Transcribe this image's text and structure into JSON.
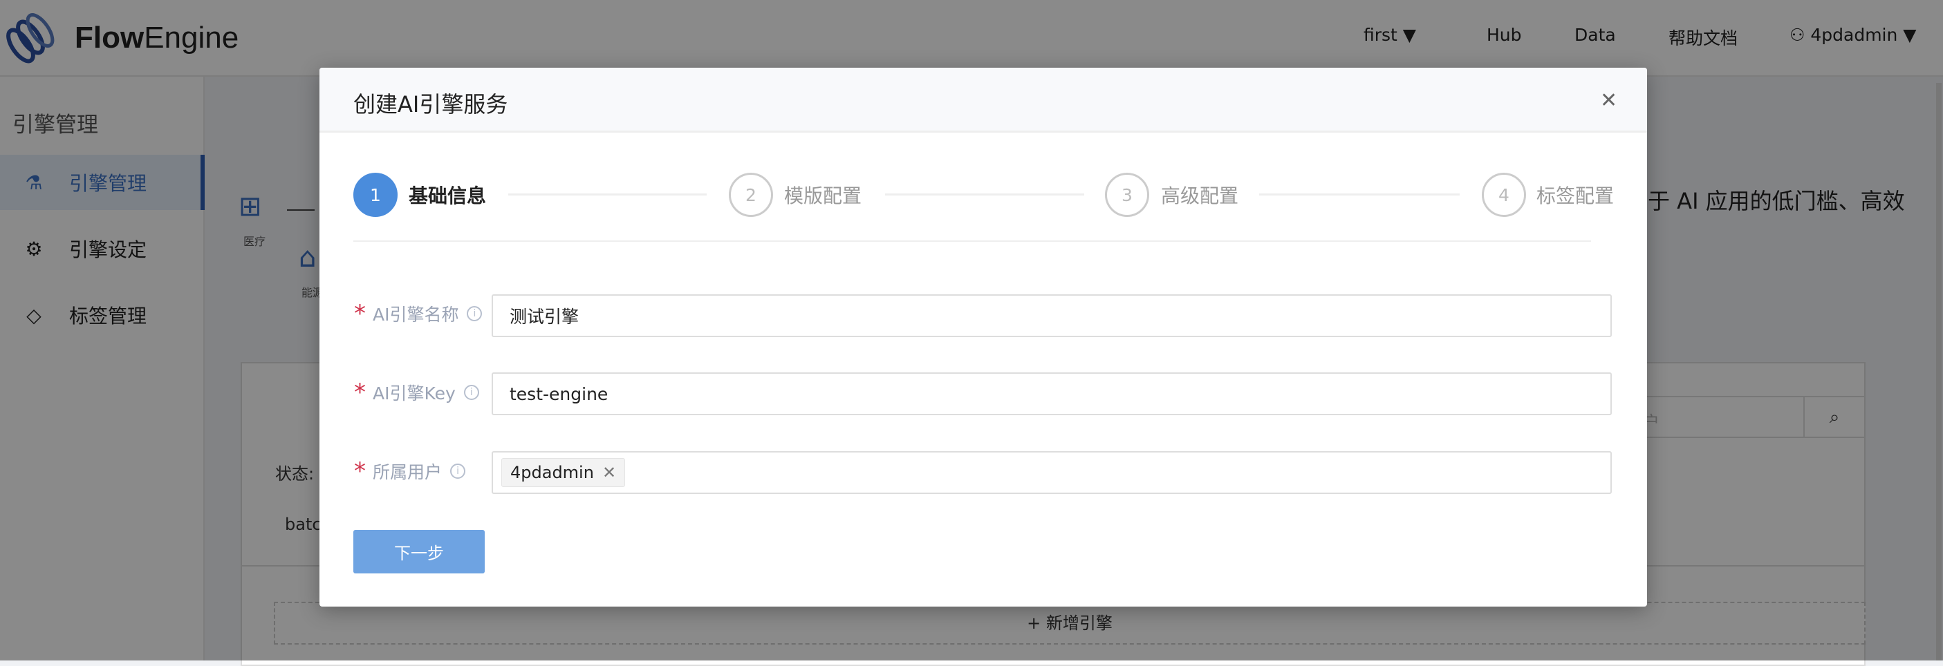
{
  "header": {
    "brand": {
      "bold": "Flow",
      "light": "Engine"
    },
    "project": "first",
    "nav": [
      "Hub",
      "Data",
      "帮助文档"
    ],
    "user": "4pdadmin"
  },
  "sidebar": {
    "title": "引擎管理",
    "items": [
      {
        "label": "引擎管理",
        "icon": "flask-icon",
        "active": true
      },
      {
        "label": "引擎设定",
        "icon": "gear-icon"
      },
      {
        "label": "标签管理",
        "icon": "tag-icon"
      }
    ]
  },
  "background": {
    "intro": "于 AI 应用的低门槛、高效",
    "icons": [
      "医疗",
      "能源"
    ],
    "status_label": "状态:",
    "row_text": "batc",
    "search_placeholder": "用户",
    "add_button": "+ 新增引擎"
  },
  "modal": {
    "title": "创建AI引擎服务",
    "steps": [
      {
        "num": "1",
        "label": "基础信息"
      },
      {
        "num": "2",
        "label": "模版配置"
      },
      {
        "num": "3",
        "label": "高级配置"
      },
      {
        "num": "4",
        "label": "标签配置"
      }
    ],
    "current_step": 1,
    "fields": [
      {
        "label": "AI引擎名称",
        "value": "测试引擎"
      },
      {
        "label": "AI引擎Key",
        "value": "test-engine"
      },
      {
        "label": "所属用户",
        "tags": [
          "4pdadmin"
        ]
      }
    ],
    "next_label": "下一步"
  },
  "colors": {
    "primary": "#4a8cdc",
    "required": "#d0344c"
  }
}
